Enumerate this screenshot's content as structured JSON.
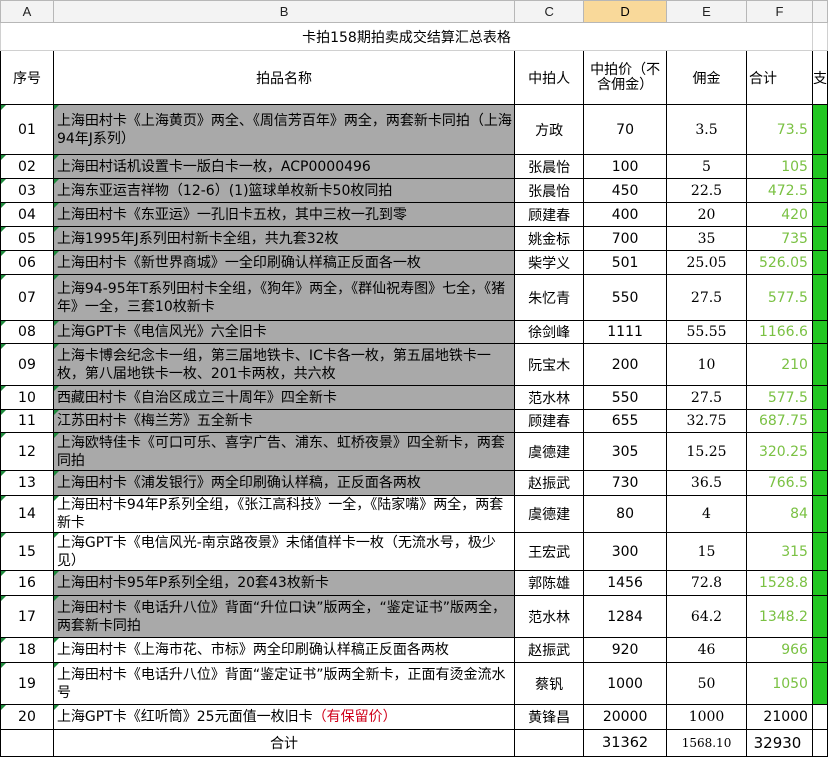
{
  "columns": [
    "A",
    "B",
    "C",
    "D",
    "E",
    "F",
    ""
  ],
  "sheet_title": "卡拍158期拍卖成交结算汇总表格",
  "headers": {
    "seq": "序号",
    "name": "拍品名称",
    "buyer": "中拍人",
    "price": "中拍价（不含佣金）",
    "fee": "佣金",
    "total": "合计",
    "extra": "支"
  },
  "rows": [
    {
      "seq": "01",
      "name": "上海田村卡《上海黄页》两全、《周信芳百年》两全，两套新卡同拍（上海94年J系列）",
      "buyer": "方政",
      "price": "70",
      "fee": "3.5",
      "total": "73.5"
    },
    {
      "seq": "02",
      "name": "上海田村话机设置卡一版白卡一枚，ACP0000496",
      "buyer": "张晨怡",
      "price": "100",
      "fee": "5",
      "total": "105"
    },
    {
      "seq": "03",
      "name": "上海东亚运吉祥物（12-6）(1)篮球单枚新卡50枚同拍",
      "buyer": "张晨怡",
      "price": "450",
      "fee": "22.5",
      "total": "472.5"
    },
    {
      "seq": "04",
      "name": "上海田村卡《东亚运》一孔旧卡五枚，其中三枚一孔到零",
      "buyer": "顾建春",
      "price": "400",
      "fee": "20",
      "total": "420"
    },
    {
      "seq": "05",
      "name": "上海1995年J系列田村新卡全组，共九套32枚",
      "buyer": "姚金标",
      "price": "700",
      "fee": "35",
      "total": "735"
    },
    {
      "seq": "06",
      "name": "上海田村卡《新世界商城》一全印刷确认样稿正反面各一枚",
      "buyer": "柴学义",
      "price": "501",
      "fee": "25.05",
      "total": "526.05"
    },
    {
      "seq": "07",
      "name": "上海94-95年T系列田村卡全组，《狗年》两全，《群仙祝寿图》七全，《猪年》一全，三套10枚新卡",
      "buyer": "朱忆青",
      "price": "550",
      "fee": "27.5",
      "total": "577.5"
    },
    {
      "seq": "08",
      "name": "上海GPT卡《电信风光》六全旧卡",
      "buyer": "徐剑峰",
      "price": "1111",
      "fee": "55.55",
      "total": "1166.6"
    },
    {
      "seq": "09",
      "name": "上海卡博会纪念卡一组，第三届地铁卡、IC卡各一枚，第五届地铁卡一枚，第八届地铁卡一枚、201卡两枚，共六枚",
      "buyer": "阮宝木",
      "price": "200",
      "fee": "10",
      "total": "210"
    },
    {
      "seq": "10",
      "name": "西藏田村卡《自治区成立三十周年》四全新卡",
      "buyer": "范水林",
      "price": "550",
      "fee": "27.5",
      "total": "577.5"
    },
    {
      "seq": "11",
      "name": "江苏田村卡《梅兰芳》五全新卡",
      "buyer": "顾建春",
      "price": "655",
      "fee": "32.75",
      "total": "687.75"
    },
    {
      "seq": "12",
      "name": "上海欧特佳卡《可口可乐、喜字广告、浦东、虹桥夜景》四全新卡，两套同拍",
      "buyer": "虞德建",
      "price": "305",
      "fee": "15.25",
      "total": "320.25"
    },
    {
      "seq": "13",
      "name": "上海田村卡《浦发银行》两全印刷确认样稿，正反面各两枚",
      "buyer": "赵振武",
      "price": "730",
      "fee": "36.5",
      "total": "766.5"
    },
    {
      "seq": "14",
      "name": "上海田村卡94年P系列全组，《张江高科技》一全，《陆家嘴》两全，两套新卡",
      "buyer": "虞德建",
      "price": "80",
      "fee": "4",
      "total": "84"
    },
    {
      "seq": "15",
      "name": "上海GPT卡《电信风光-南京路夜景》未储值样卡一枚（无流水号，极少见）",
      "buyer": "王宏武",
      "price": "300",
      "fee": "15",
      "total": "315"
    },
    {
      "seq": "16",
      "name": "上海田村卡95年P系列全组，20套43枚新卡",
      "buyer": "郭陈雄",
      "price": "1456",
      "fee": "72.8",
      "total": "1528.8"
    },
    {
      "seq": "17",
      "name": "上海田村卡《电话升八位》背面“升位口诀”版两全，“鉴定证书”版两全，两套新卡同拍",
      "buyer": "范水林",
      "price": "1284",
      "fee": "64.2",
      "total": "1348.2"
    },
    {
      "seq": "18",
      "name": "上海田村卡《上海市花、市标》两全印刷确认样稿正反面各两枚",
      "buyer": "赵振武",
      "price": "920",
      "fee": "46",
      "total": "966"
    },
    {
      "seq": "19",
      "name": "上海田村卡《电话升八位》背面“鉴定证书”版两全新卡，正面有烫金流水号",
      "buyer": "蔡钒",
      "price": "1000",
      "fee": "50",
      "total": "1050"
    },
    {
      "seq": "20",
      "name": "上海GPT卡《红听筒》25元面值一枚旧卡",
      "name_note": "（有保留价）",
      "buyer": "黄锋昌",
      "price": "20000",
      "fee": "1000",
      "total": "21000"
    }
  ],
  "summary": {
    "label": "合计",
    "price": "31362",
    "fee": "1568.10",
    "total": "32930"
  },
  "colors": {
    "gray_cell": "#a9a9a9",
    "green_total": "#7ac143",
    "green_bar": "#22c722",
    "note_red": "#d0021b",
    "selected_col": "#f9d99a"
  }
}
